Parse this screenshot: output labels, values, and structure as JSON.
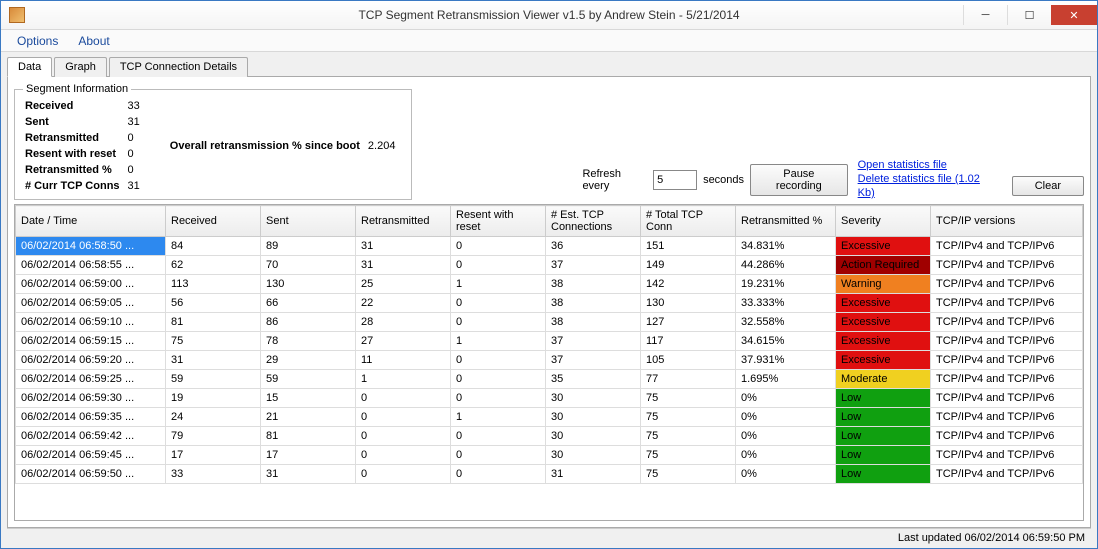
{
  "window": {
    "title": "TCP Segment Retransmission Viewer v1.5 by Andrew Stein - 5/21/2014"
  },
  "menu": {
    "options": "Options",
    "about": "About"
  },
  "tabs": {
    "data": "Data",
    "graph": "Graph",
    "details": "TCP Connection Details"
  },
  "seginfo": {
    "legend": "Segment Information",
    "received_lbl": "Received",
    "received": "33",
    "sent_lbl": "Sent",
    "sent": "31",
    "retrans_lbl": "Retransmitted",
    "retrans": "0",
    "resent_lbl": "Resent with reset",
    "resent": "0",
    "retranspct_lbl": "Retransmitted %",
    "retranspct": "0",
    "curr_lbl": "# Curr TCP Conns",
    "curr": "31",
    "overall_lbl": "Overall retransmission % since boot",
    "overall": "2.204"
  },
  "refresh": {
    "label1": "Refresh every",
    "value": "5",
    "label2": "seconds",
    "pause": "Pause recording",
    "clear": "Clear"
  },
  "links": {
    "open": "Open statistics file",
    "delete": "Delete statistics file (1.02 Kb)"
  },
  "columns": {
    "c0": "Date / Time",
    "c1": "Received",
    "c2": "Sent",
    "c3": "Retransmitted",
    "c4": "Resent with reset",
    "c5": "# Est. TCP Connections",
    "c6": "# Total TCP Conn",
    "c7": "Retransmitted %",
    "c8": "Severity",
    "c9": "TCP/IP versions"
  },
  "rows": [
    {
      "dt": "06/02/2014 06:58:50 ...",
      "rx": "84",
      "tx": "89",
      "rt": "31",
      "rs": "0",
      "est": "36",
      "tot": "151",
      "pct": "34.831%",
      "sev": "Excessive",
      "ver": "TCP/IPv4 and TCP/IPv6"
    },
    {
      "dt": "06/02/2014 06:58:55 ...",
      "rx": "62",
      "tx": "70",
      "rt": "31",
      "rs": "0",
      "est": "37",
      "tot": "149",
      "pct": "44.286%",
      "sev": "Action Required",
      "ver": "TCP/IPv4 and TCP/IPv6"
    },
    {
      "dt": "06/02/2014 06:59:00 ...",
      "rx": "113",
      "tx": "130",
      "rt": "25",
      "rs": "1",
      "est": "38",
      "tot": "142",
      "pct": "19.231%",
      "sev": "Warning",
      "ver": "TCP/IPv4 and TCP/IPv6"
    },
    {
      "dt": "06/02/2014 06:59:05 ...",
      "rx": "56",
      "tx": "66",
      "rt": "22",
      "rs": "0",
      "est": "38",
      "tot": "130",
      "pct": "33.333%",
      "sev": "Excessive",
      "ver": "TCP/IPv4 and TCP/IPv6"
    },
    {
      "dt": "06/02/2014 06:59:10 ...",
      "rx": "81",
      "tx": "86",
      "rt": "28",
      "rs": "0",
      "est": "38",
      "tot": "127",
      "pct": "32.558%",
      "sev": "Excessive",
      "ver": "TCP/IPv4 and TCP/IPv6"
    },
    {
      "dt": "06/02/2014 06:59:15 ...",
      "rx": "75",
      "tx": "78",
      "rt": "27",
      "rs": "1",
      "est": "37",
      "tot": "117",
      "pct": "34.615%",
      "sev": "Excessive",
      "ver": "TCP/IPv4 and TCP/IPv6"
    },
    {
      "dt": "06/02/2014 06:59:20 ...",
      "rx": "31",
      "tx": "29",
      "rt": "11",
      "rs": "0",
      "est": "37",
      "tot": "105",
      "pct": "37.931%",
      "sev": "Excessive",
      "ver": "TCP/IPv4 and TCP/IPv6"
    },
    {
      "dt": "06/02/2014 06:59:25 ...",
      "rx": "59",
      "tx": "59",
      "rt": "1",
      "rs": "0",
      "est": "35",
      "tot": "77",
      "pct": "1.695%",
      "sev": "Moderate",
      "ver": "TCP/IPv4 and TCP/IPv6"
    },
    {
      "dt": "06/02/2014 06:59:30 ...",
      "rx": "19",
      "tx": "15",
      "rt": "0",
      "rs": "0",
      "est": "30",
      "tot": "75",
      "pct": "0%",
      "sev": "Low",
      "ver": "TCP/IPv4 and TCP/IPv6"
    },
    {
      "dt": "06/02/2014 06:59:35 ...",
      "rx": "24",
      "tx": "21",
      "rt": "0",
      "rs": "1",
      "est": "30",
      "tot": "75",
      "pct": "0%",
      "sev": "Low",
      "ver": "TCP/IPv4 and TCP/IPv6"
    },
    {
      "dt": "06/02/2014 06:59:42 ...",
      "rx": "79",
      "tx": "81",
      "rt": "0",
      "rs": "0",
      "est": "30",
      "tot": "75",
      "pct": "0%",
      "sev": "Low",
      "ver": "TCP/IPv4 and TCP/IPv6"
    },
    {
      "dt": "06/02/2014 06:59:45 ...",
      "rx": "17",
      "tx": "17",
      "rt": "0",
      "rs": "0",
      "est": "30",
      "tot": "75",
      "pct": "0%",
      "sev": "Low",
      "ver": "TCP/IPv4 and TCP/IPv6"
    },
    {
      "dt": "06/02/2014 06:59:50 ...",
      "rx": "33",
      "tx": "31",
      "rt": "0",
      "rs": "0",
      "est": "31",
      "tot": "75",
      "pct": "0%",
      "sev": "Low",
      "ver": "TCP/IPv4 and TCP/IPv6"
    }
  ],
  "status": {
    "last_updated": "Last updated 06/02/2014 06:59:50 PM"
  }
}
